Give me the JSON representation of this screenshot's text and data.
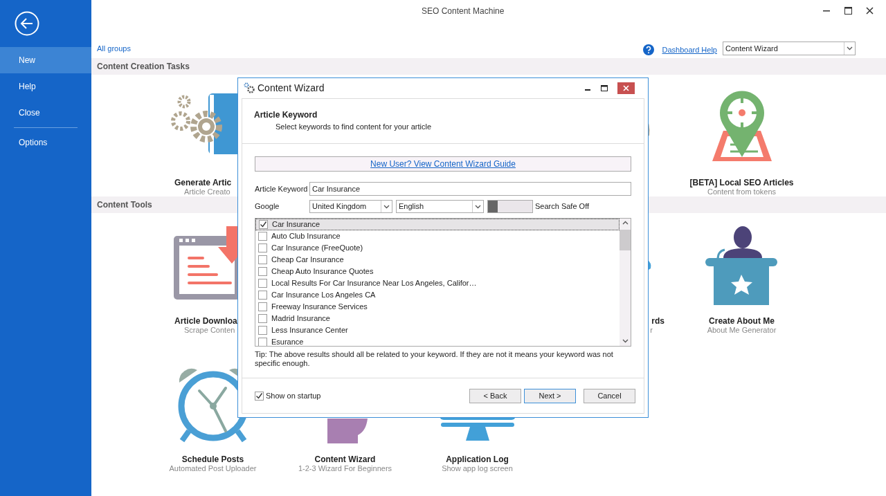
{
  "window": {
    "title": "SEO Content Machine"
  },
  "sidebar": {
    "items": [
      {
        "kind": "item",
        "label": "New",
        "selected": true
      },
      {
        "kind": "item",
        "label": "Help",
        "selected": false
      },
      {
        "kind": "item",
        "label": "Close",
        "selected": false
      },
      {
        "kind": "separator"
      },
      {
        "kind": "item",
        "label": "Options",
        "selected": false
      }
    ]
  },
  "toolbar": {
    "groups_link": "All groups",
    "help_link": "Dashboard Help",
    "group_select": "Content Wizard"
  },
  "sections": [
    {
      "title": "Content Creation Tasks",
      "tiles": [
        {
          "kind": "gears",
          "title": "Generate Artic",
          "subtitle": "Article Creato"
        },
        {
          "kind": "covered"
        },
        {
          "kind": "covered"
        },
        {
          "kind": "olive_edge"
        },
        {
          "kind": "pin",
          "title": "[BETA] Local SEO Articles",
          "subtitle": "Content from tokens"
        }
      ]
    },
    {
      "title": "Content Tools",
      "tiles": [
        {
          "kind": "download",
          "title": "Article Downloa",
          "subtitle": "Scrape Conten"
        },
        {
          "kind": "covered"
        },
        {
          "kind": "covered"
        },
        {
          "kind": "blue_edge",
          "title": "rds",
          "subtitle": "r"
        },
        {
          "kind": "podium",
          "title": "Create About Me",
          "subtitle": "About Me Generator"
        },
        {
          "kind": "clock",
          "title": "Schedule Posts",
          "subtitle": "Automated Post Uploader"
        },
        {
          "kind": "head",
          "title": "Content Wizard",
          "subtitle": "1-2-3 Wizard For Beginners"
        },
        {
          "kind": "monitor",
          "title": "Application Log",
          "subtitle": "Show app log screen"
        }
      ]
    }
  ],
  "dialog": {
    "title": "Content Wizard",
    "heading": "Article Keyword",
    "subheading": "Select keywords to find content for your article",
    "guide_link": "New User? View Content Wizard Guide",
    "keyword_label": "Article Keyword",
    "keyword_value": "Car Insurance",
    "google_label": "Google",
    "country": "United Kingdom",
    "language": "English",
    "safe_search_on": false,
    "safe_search_label": "Search Safe Off",
    "results": [
      {
        "label": "Car Insurance",
        "checked": true,
        "selected": true
      },
      {
        "label": "Auto Club Insurance",
        "checked": false,
        "selected": false
      },
      {
        "label": "Car Insurance (FreeQuote)",
        "checked": false,
        "selected": false
      },
      {
        "label": "Cheap Car Insurance",
        "checked": false,
        "selected": false
      },
      {
        "label": "Cheap Auto Insurance Quotes",
        "checked": false,
        "selected": false
      },
      {
        "label": "Local Results For Car Insurance Near Los Angeles, Califor…",
        "checked": false,
        "selected": false
      },
      {
        "label": "Car Insurance Los Angeles CA",
        "checked": false,
        "selected": false
      },
      {
        "label": "Freeway Insurance Services",
        "checked": false,
        "selected": false
      },
      {
        "label": "Madrid Insurance",
        "checked": false,
        "selected": false
      },
      {
        "label": "Less Insurance Center",
        "checked": false,
        "selected": false
      },
      {
        "label": "Esurance",
        "checked": false,
        "selected": false
      }
    ],
    "tip": "Tip: The above results should all be related to your keyword. If they are not it means your keyword was not specific enough.",
    "show_on_startup": {
      "label": "Show on startup",
      "checked": true
    },
    "buttons": [
      {
        "label": "< Back",
        "default": false
      },
      {
        "label": "Next >",
        "default": true
      },
      {
        "label": "Cancel",
        "default": false
      }
    ]
  }
}
